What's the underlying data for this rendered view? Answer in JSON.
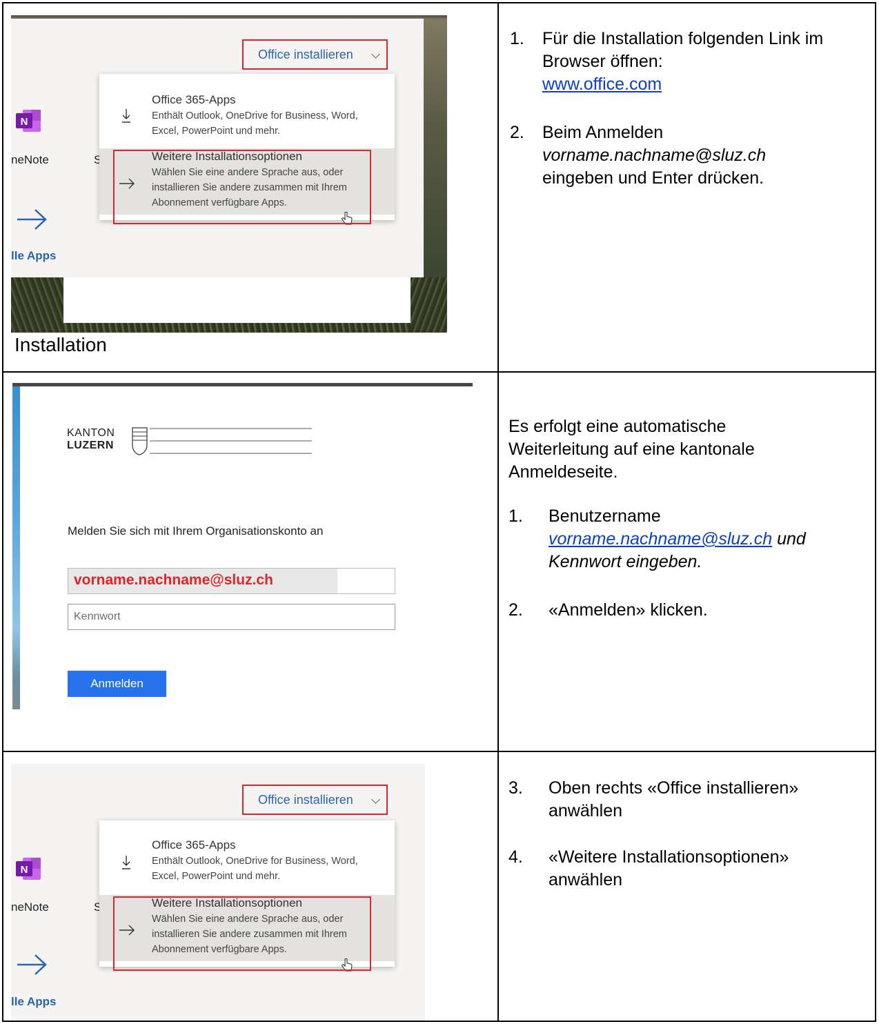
{
  "office_menu": {
    "install_button": "Office installieren",
    "apps_title": "Office 365-Apps",
    "apps_desc": "Enthält Outlook, OneDrive for Business, Word, Excel, PowerPoint und mehr.",
    "more_title": "Weitere Installationsoptionen",
    "more_desc": "Wählen Sie eine andere Sprache aus, oder installieren Sie andere zusammen mit Ihrem Abonnement verfügbare Apps.",
    "onenote_label": "neNote",
    "s_label": "S",
    "alle_apps": "lle Apps",
    "onenote_icon_letter": "N"
  },
  "row1": {
    "caption": "Installation",
    "step1_num": "1.",
    "step1_text": "Für die Installation folgenden Link im Browser öffnen:",
    "step1_link": "www.office.com",
    "step2_num": "2.",
    "step2_pre": "Beim Anmelden",
    "step2_email": "vorname.nachname@sluz.ch",
    "step2_post": "eingeben und Enter drücken."
  },
  "login": {
    "logo_kanton": "KANTON",
    "logo_luzern": "LUZERN",
    "prompt": "Melden Sie sich mit Ihrem Organisationskonto an",
    "username_value": "vorname.nachname@sluz.ch",
    "password_placeholder": "Kennwort",
    "submit_label": "Anmelden"
  },
  "row2": {
    "intro": "Es erfolgt eine automatische Weiterleitung auf eine kantonale Anmeldeseite.",
    "step1_num": "1.",
    "step1_pre": "Benutzername",
    "step1_link": "vorname.nachname@sluz.ch",
    "step1_post_a": "und",
    "step1_post_b": "Kennwort eingeben.",
    "step2_num": "2.",
    "step2_text": "«Anmelden» klicken."
  },
  "row3": {
    "step3_num": "3.",
    "step3_text": "Oben rechts «Office installieren» anwählen",
    "step4_num": "4.",
    "step4_text": "«Weitere Installationsoptionen» anwählen"
  },
  "colors": {
    "highlight_red": "#d9262c",
    "office_blue": "#2a64b0",
    "onenote_purple": "#7719aa",
    "signin_blue": "#2672ec",
    "link_blue": "#0b3fc7"
  }
}
